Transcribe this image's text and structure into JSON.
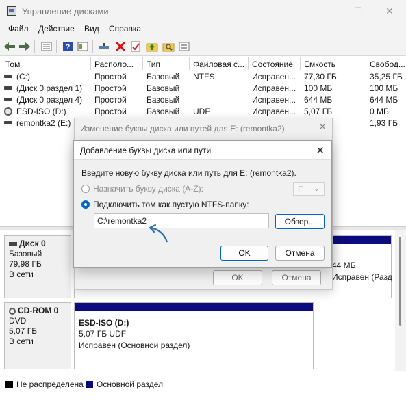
{
  "window": {
    "title": "Управление дисками",
    "minimize_glyph": "—",
    "maximize_glyph": "☐",
    "close_glyph": "✕"
  },
  "menu": [
    "Файл",
    "Действие",
    "Вид",
    "Справка"
  ],
  "toolbar_icons": [
    "back-icon",
    "forward-icon",
    "list-view-icon",
    "help-icon",
    "console-icon",
    "connect-icon",
    "delete-icon",
    "properties-icon",
    "up-folder-icon",
    "search-icon",
    "options-icon"
  ],
  "columns": [
    "Том",
    "Располо...",
    "Тип",
    "Файловая с...",
    "Состояние",
    "Емкость",
    "Свобод..."
  ],
  "volumes": [
    {
      "name": "(C:)",
      "layout": "Простой",
      "type": "Базовый",
      "fs": "NTFS",
      "status": "Исправен...",
      "capacity": "77,30 ГБ",
      "free": "35,25 ГБ",
      "icon": "disk-icon"
    },
    {
      "name": "(Диск 0 раздел 1)",
      "layout": "Простой",
      "type": "Базовый",
      "fs": "",
      "status": "Исправен...",
      "capacity": "100 МБ",
      "free": "100 МБ",
      "icon": "disk-icon"
    },
    {
      "name": "(Диск 0 раздел 4)",
      "layout": "Простой",
      "type": "Базовый",
      "fs": "",
      "status": "Исправен...",
      "capacity": "644 МБ",
      "free": "644 МБ",
      "icon": "disk-icon"
    },
    {
      "name": "ESD-ISO (D:)",
      "layout": "Простой",
      "type": "Базовый",
      "fs": "UDF",
      "status": "Исправен...",
      "capacity": "5,07 ГБ",
      "free": "0 МБ",
      "icon": "cd-icon"
    },
    {
      "name": "remontka2 (E:)",
      "layout": "",
      "type": "",
      "fs": "",
      "status": "",
      "capacity": "",
      "free": "1,93 ГБ",
      "icon": "disk-icon"
    }
  ],
  "disk0": {
    "name": "Диск 0",
    "type": "Базовый",
    "size": "79,98 ГБ",
    "state": "В сети",
    "right_part_size": "44 МБ",
    "right_part_status": "Исправен (Разд"
  },
  "cdrom0": {
    "name": "CD-ROM 0",
    "type": "DVD",
    "size": "5,07 ГБ",
    "state": "В сети",
    "part_name": "ESD-ISO  (D:)",
    "part_size": "5,07 ГБ UDF",
    "part_status": "Исправен (Основной раздел)"
  },
  "legend": [
    {
      "label": "Не распределена",
      "color": "#000000"
    },
    {
      "label": "Основной раздел",
      "color": "#0b0b7d"
    }
  ],
  "back_dialog": {
    "title": "Изменение буквы диска или путей для E: (remontka2)",
    "ok": "OK",
    "cancel": "Отмена"
  },
  "dialog": {
    "title": "Добавление буквы диска или пути",
    "prompt": "Введите новую букву диска или путь для E: (remontka2).",
    "option_letter": "Назначить букву диска (A-Z):",
    "letter_value": "E",
    "option_folder": "Подключить том как пустую NTFS-папку:",
    "path_value": "C:\\remontka2",
    "browse": "Обзор...",
    "ok": "OK",
    "cancel": "Отмена"
  },
  "colors": {
    "primary_partition": "#0b0b7d",
    "accent": "#0067c0",
    "annotation_arrow": "#2c6fb0"
  }
}
